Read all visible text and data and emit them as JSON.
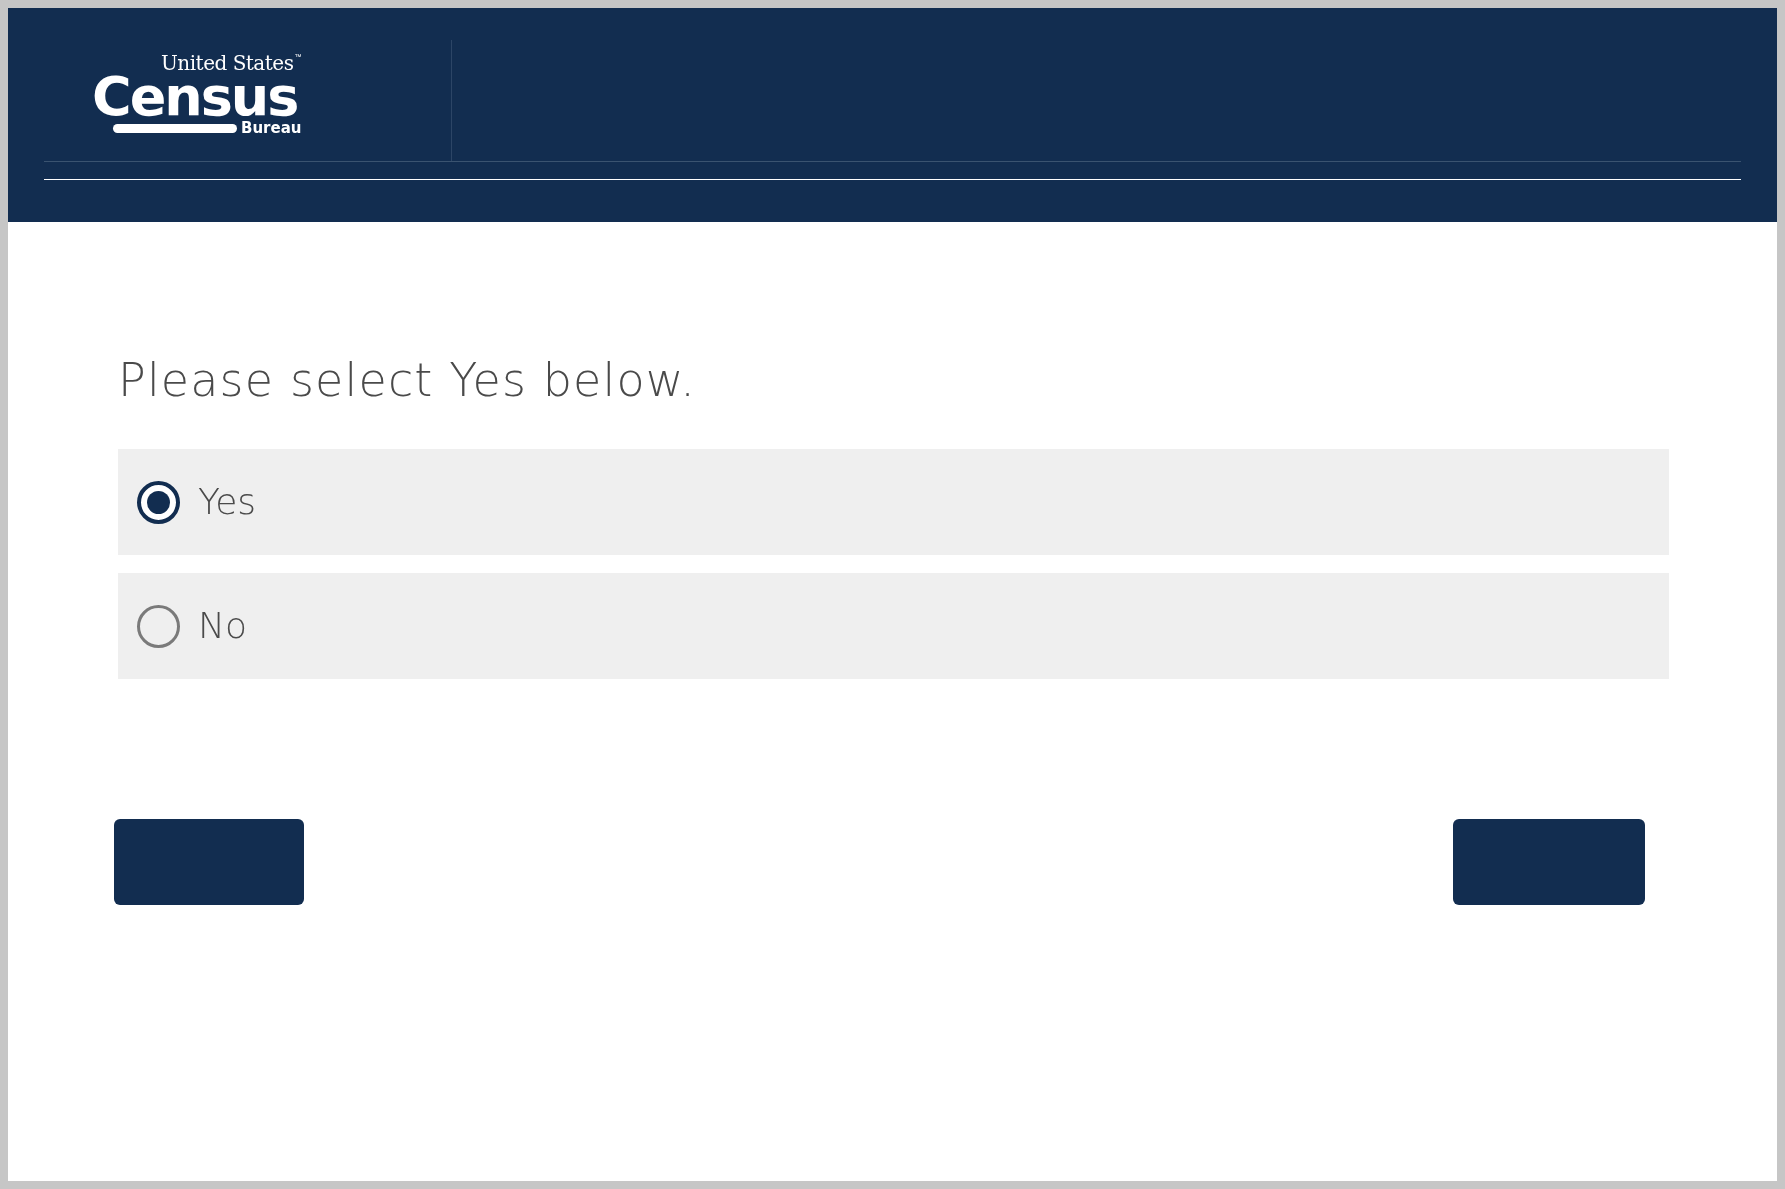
{
  "logo": {
    "top": "United States",
    "trademark": "™",
    "main": "Census",
    "bottom": "Bureau"
  },
  "question": "Please select Yes below.",
  "options": [
    {
      "label": "Yes",
      "selected": true
    },
    {
      "label": "No",
      "selected": false
    }
  ]
}
